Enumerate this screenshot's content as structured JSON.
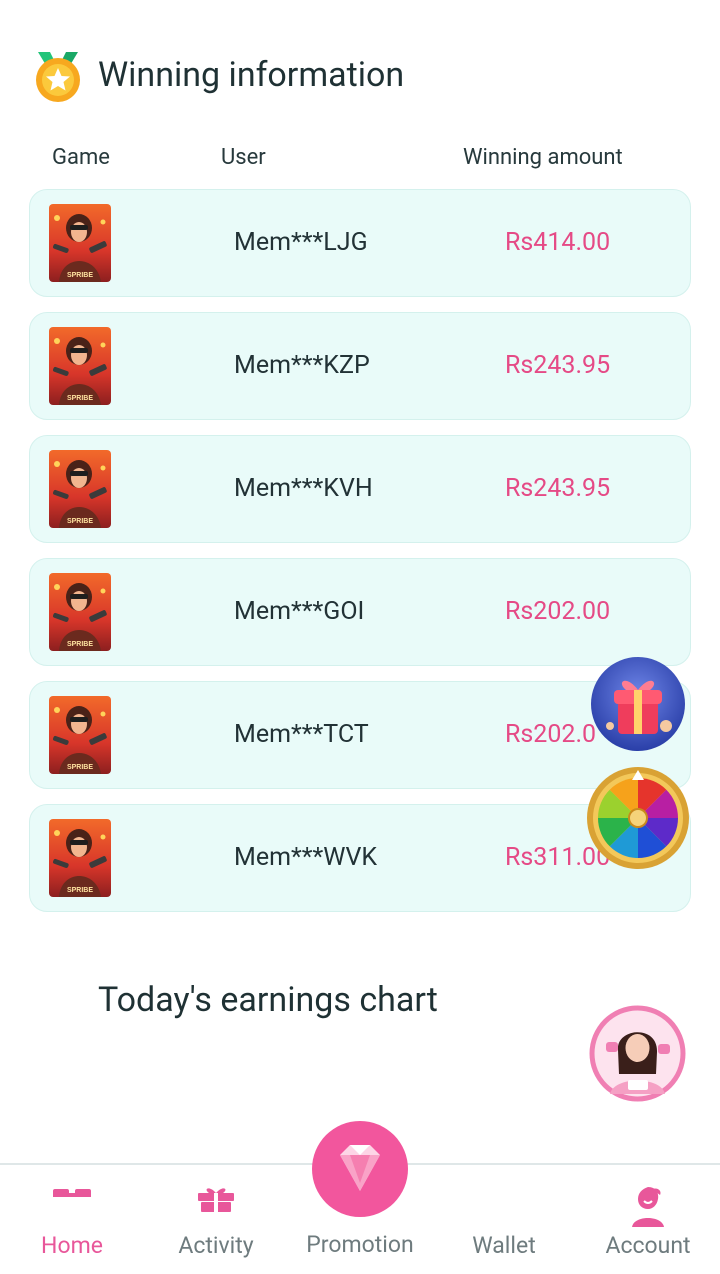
{
  "winning": {
    "title": "Winning information",
    "headers": {
      "game": "Game",
      "user": "User",
      "amount": "Winning amount"
    },
    "game_thumb_label": "SPRIBE",
    "rows": [
      {
        "user": "Mem***LJG",
        "amount": "Rs414.00"
      },
      {
        "user": "Mem***KZP",
        "amount": "Rs243.95"
      },
      {
        "user": "Mem***KVH",
        "amount": "Rs243.95"
      },
      {
        "user": "Mem***GOI",
        "amount": "Rs202.00"
      },
      {
        "user": "Mem***TCT",
        "amount": "Rs202.0"
      },
      {
        "user": "Mem***WVK",
        "amount": "Rs311.00"
      }
    ]
  },
  "earnings": {
    "title": "Today's earnings chart"
  },
  "nav": {
    "home": "Home",
    "activity": "Activity",
    "promotion": "Promotion",
    "wallet": "Wallet",
    "account": "Account"
  },
  "colors": {
    "accent": "#e8579a",
    "amount": "#e54a86",
    "row_bg": "#e9fbf9"
  }
}
